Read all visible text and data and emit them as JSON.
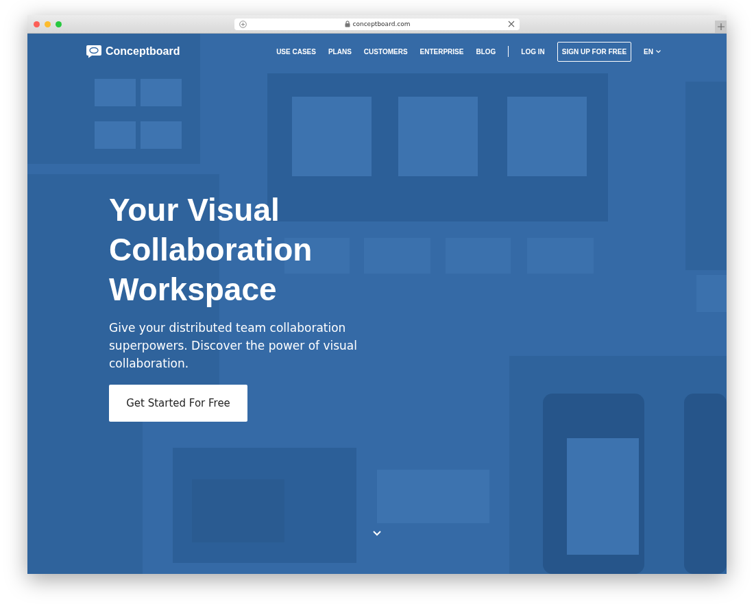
{
  "browser": {
    "address": "conceptboard.com"
  },
  "brand": {
    "name": "Conceptboard"
  },
  "nav": {
    "links": [
      {
        "label": "USE CASES"
      },
      {
        "label": "PLANS"
      },
      {
        "label": "CUSTOMERS"
      },
      {
        "label": "ENTERPRISE"
      },
      {
        "label": "BLOG"
      }
    ],
    "login": "LOG IN",
    "signup": "SIGN UP FOR FREE",
    "language": "EN"
  },
  "hero": {
    "title": "Your Visual Collaboration Workspace",
    "subtitle": "Give your distributed team collaboration superpowers. Discover the power of visual collaboration.",
    "cta": "Get Started For Free"
  }
}
